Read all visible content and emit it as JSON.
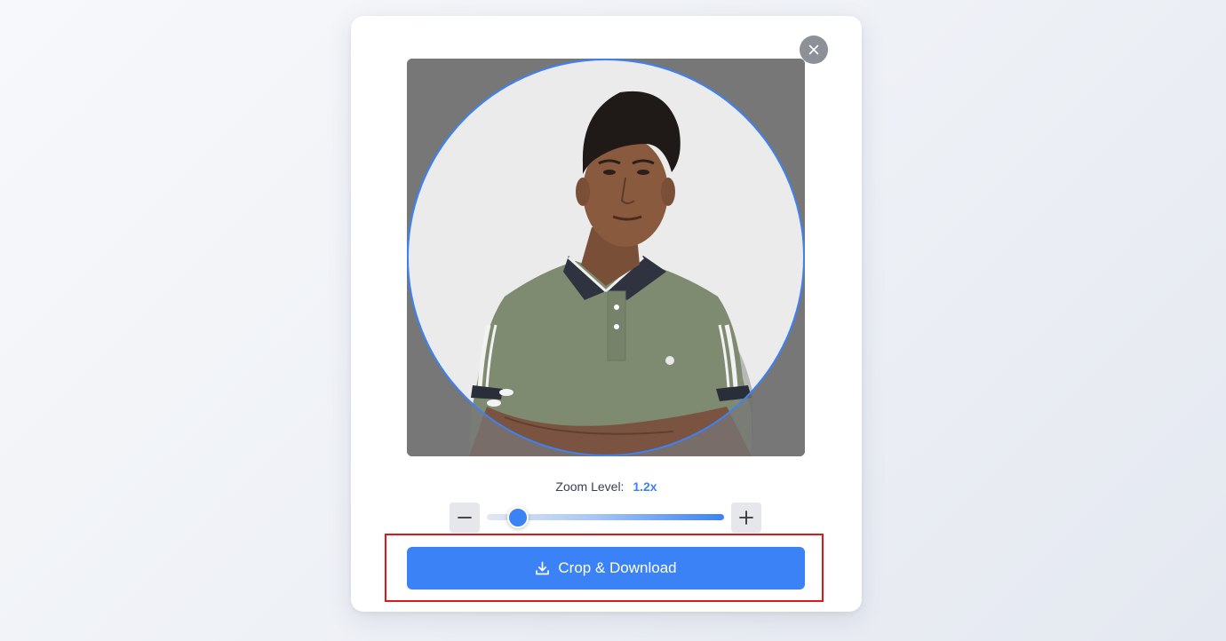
{
  "dialog": {
    "close_icon": "close-icon",
    "photo_description": "Person in olive-green polo shirt with arms crossed",
    "zoom": {
      "label": "Zoom Level:",
      "value": "1.2x",
      "minus_icon": "minus-icon",
      "plus_icon": "plus-icon"
    },
    "download_button": {
      "label": "Crop & Download",
      "icon": "download-icon"
    }
  },
  "colors": {
    "accent": "#3b82f6",
    "overlay": "#777777",
    "highlight": "#e0161b",
    "close_bg": "#8d9096"
  }
}
